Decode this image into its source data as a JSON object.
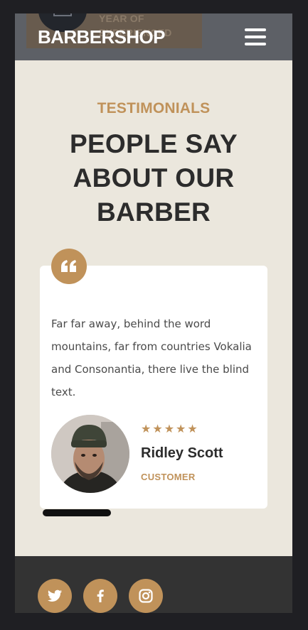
{
  "header": {
    "brand": "BARBERSHOP",
    "ghost_text": "YEAR OF EXPERIENCED",
    "menu_icon": "hamburger-menu-icon"
  },
  "testimonials": {
    "eyebrow": "TESTIMONIALS",
    "heading_line1": "PEOPLE SAY",
    "heading_line2": "ABOUT OUR BARBER"
  },
  "card": {
    "quote_icon": "quote-icon",
    "text": "Far far away, behind the word mountains, far from countries Vokalia and Consonantia, there live the blind text.",
    "stars": "★★★★★",
    "rating": 5,
    "name": "Ridley Scott",
    "role": "CUSTOMER"
  },
  "footer": {
    "social": [
      "twitter-icon",
      "facebook-icon",
      "instagram-icon"
    ]
  },
  "colors": {
    "accent": "#c0925a",
    "background": "#ebe7dd",
    "header": "#5d6066",
    "footer": "#333333",
    "text_dark": "#2c2c2c"
  }
}
